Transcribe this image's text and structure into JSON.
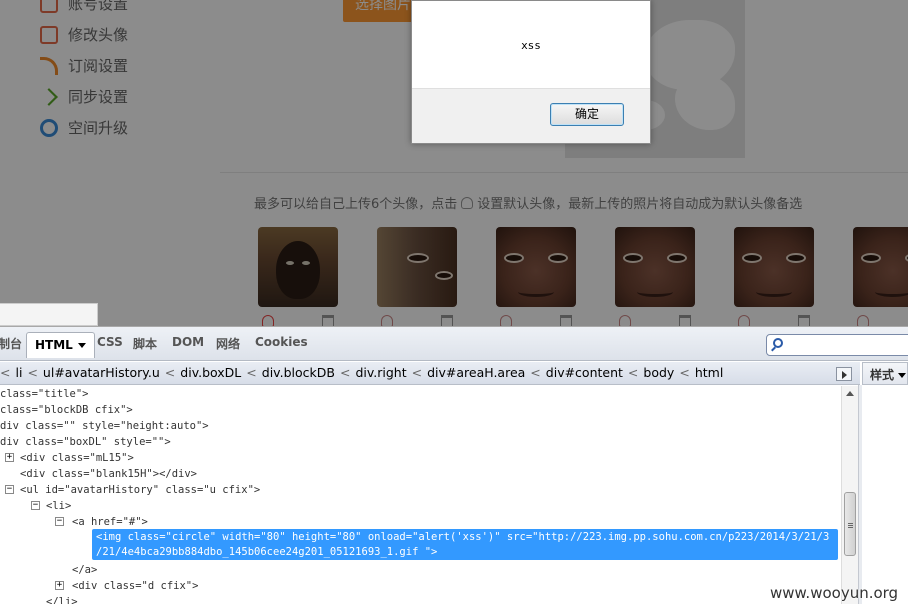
{
  "side_menu": {
    "items": [
      {
        "label": "账号设置",
        "icon": "account-icon"
      },
      {
        "label": "修改头像",
        "icon": "avatar-icon"
      },
      {
        "label": "订阅设置",
        "icon": "rss-icon"
      },
      {
        "label": "同步设置",
        "icon": "sync-icon"
      },
      {
        "label": "空间升级",
        "icon": "upgrade-icon"
      }
    ]
  },
  "choose_image_button": "选择图片",
  "history_hint_pre": "最多可以给自己上传6个头像，点击",
  "history_hint_post": "设置默认头像，最新上传的照片将自动成为默认头像备选",
  "alert": {
    "message": "xss",
    "ok_label": "确定"
  },
  "devtools": {
    "tabs": [
      "制台",
      "HTML",
      "CSS",
      "脚本",
      "DOM",
      "网络",
      "Cookies"
    ],
    "active_tab": "HTML",
    "breadcrumb": [
      "li",
      "ul#avatarHistory.u",
      "div.boxDL",
      "div.blockDB",
      "div.right",
      "div#areaH.area",
      "div#content",
      "body",
      "html"
    ],
    "side_panel_tab": "样式",
    "tree": [
      "class=\"title\">",
      "class=\"blockDB cfix\">",
      "div class=\"\" style=\"height:auto\">",
      "div class=\"boxDL\" style=\"\">",
      "<div class=\"mL15\">",
      "<div class=\"blank15H\"></div>",
      "<ul id=\"avatarHistory\" class=\"u cfix\">",
      "<li>",
      "<a href=\"#\">",
      "<img class=\"circle\" width=\"80\" height=\"80\" onload=\"alert('xss')\" src=\"http://223.img.pp.sohu.com.cn/p223/2014/3/21/3",
      "/21/4e4bca29bb884dbo_145b06cee24g201_05121693_1.gif \">",
      "</a>",
      "<div class=\"d cfix\">",
      "</li>"
    ]
  },
  "watermark": "www.wooyun.org"
}
